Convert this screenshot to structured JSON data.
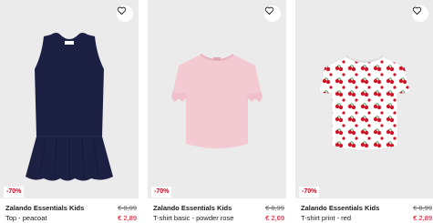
{
  "products": [
    {
      "image": "navy-sleeveless-peplum-top",
      "discount": "-70%",
      "brand": "Zalando Essentials Kids",
      "name": "Top - peacoat",
      "old_price": "€ 8,99",
      "new_price": "€ 2,89"
    },
    {
      "image": "pink-ruffle-sleeve-tshirt",
      "discount": "-70%",
      "brand": "Zalando Essentials Kids",
      "name": "T-shirt basic - powder rose",
      "old_price": "€ 8,99",
      "new_price": "€ 2,69"
    },
    {
      "image": "white-cherry-print-tshirt",
      "discount": "-70%",
      "brand": "Zalando Essentials Kids",
      "name": "T-shirt print - red",
      "old_price": "€ 8,99",
      "new_price": "€ 2,89"
    }
  ],
  "icons": {
    "wishlist": "heart-outline-icon"
  },
  "colors": {
    "discount": "#d0021b",
    "navy": "#1c2143",
    "pink": "#f3c9d2",
    "cherry": "#d0152a"
  }
}
